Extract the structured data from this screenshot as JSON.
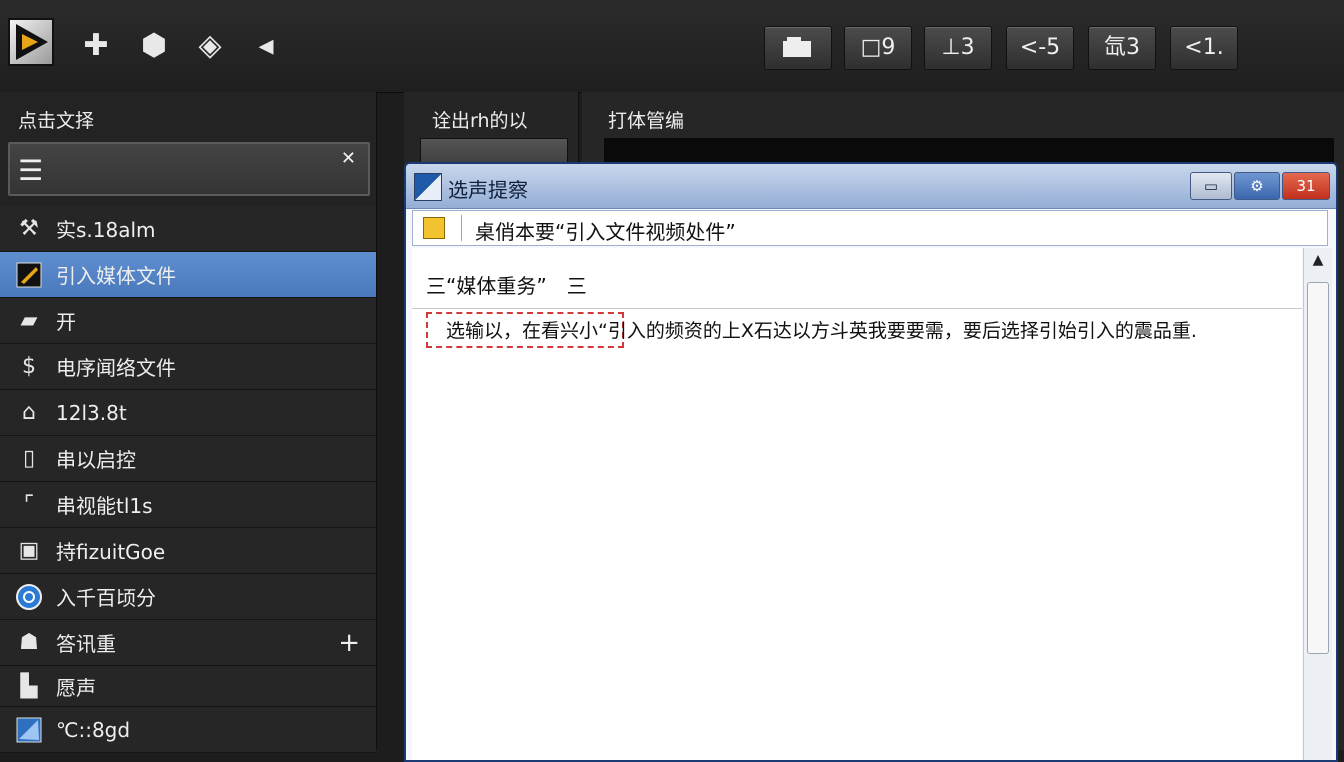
{
  "toolbar": {
    "buttons": [
      "□9",
      "⊥3",
      "<-5",
      "氙3",
      "<1."
    ]
  },
  "left_panel": {
    "title": "点击文择",
    "items": [
      {
        "label": "实s.18alm",
        "icon": "tool-icon"
      },
      {
        "label": "引入媒体文件",
        "icon": "media-import-icon",
        "selected": true
      },
      {
        "label": "开",
        "icon": "folder-icon"
      },
      {
        "label": "电序闻络文件",
        "icon": "network-file-icon"
      },
      {
        "label": "12l3.8t",
        "icon": "house-icon"
      },
      {
        "label": "串以启控",
        "icon": "frame-icon"
      },
      {
        "label": "串视能tl1s",
        "icon": "corner-icon"
      },
      {
        "label": "持fizuitGoe",
        "icon": "camera-icon"
      },
      {
        "label": "入千百顷分",
        "icon": "globe-icon"
      },
      {
        "label": "答讯重",
        "icon": "person-icon",
        "plus": "+"
      },
      {
        "label": "愿声",
        "icon": "document-icon"
      },
      {
        "label": "℃::8gd",
        "icon": "image-icon"
      }
    ]
  },
  "mid_panel": {
    "title": "诠出rh的以"
  },
  "right_panel": {
    "title": "打体管编"
  },
  "dialog": {
    "title": "选声提察",
    "window_buttons": [
      "▭",
      "⚙",
      "31"
    ],
    "address": "桌俏本要“引入文件视频处件”",
    "section_header": "三“媒体重务”　三",
    "body_text": "选输以，在看兴小“引入的频资的上X石达以方斗英我要要需，要后选择引始引入的震品重."
  }
}
